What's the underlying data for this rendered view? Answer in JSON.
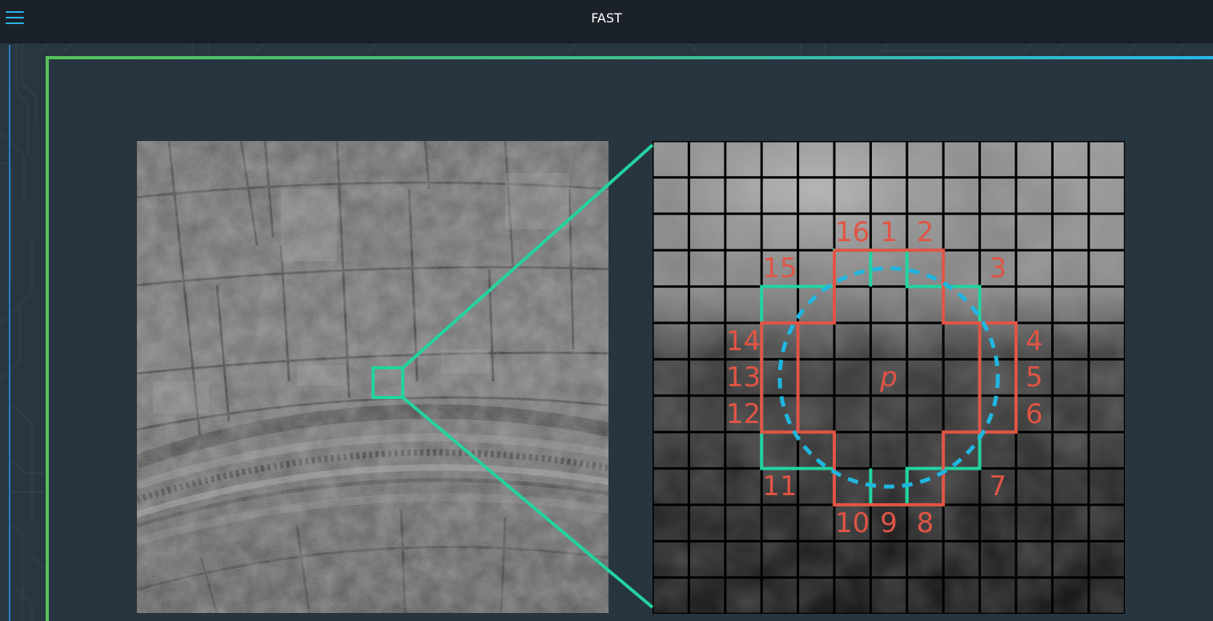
{
  "header": {
    "title": "FAST",
    "menu_icon": "hamburger-menu-icon"
  },
  "figure": {
    "center_label": "p",
    "circle_labels": [
      "1",
      "2",
      "3",
      "4",
      "5",
      "6",
      "7",
      "8",
      "9",
      "10",
      "11",
      "12",
      "13",
      "14",
      "15",
      "16"
    ],
    "colors": {
      "accent_green": "#23d3a0",
      "label_red": "#e05545",
      "circle_blue": "#20b6e0",
      "frame_green": "#55c15a",
      "frame_blue": "#28b8e8"
    }
  }
}
